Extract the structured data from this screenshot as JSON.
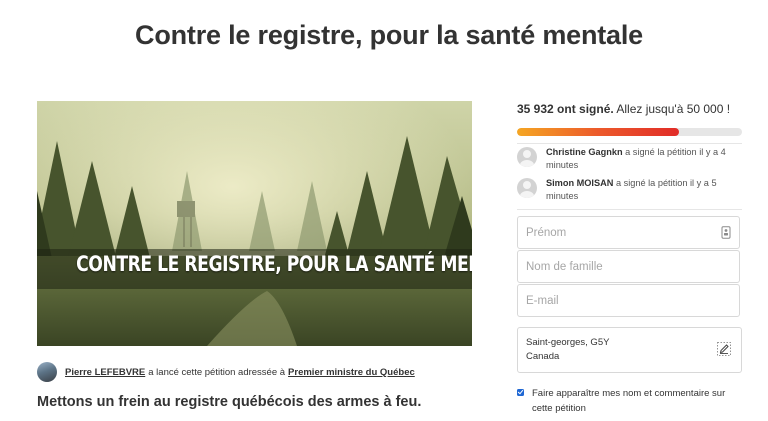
{
  "page": {
    "title": "Contre le registre, pour la santé mentale"
  },
  "hero": {
    "caption": "CONTRE LE REGISTRE, POUR LA SANTÉ MENTALE"
  },
  "starter": {
    "author": "Pierre LEFEBVRE",
    "middle_text": "a lancé cette pétition adressée à",
    "recipient": "Premier ministre du Québec"
  },
  "lead_text": "Mettons un frein au registre québécois des armes à feu.",
  "signatures": {
    "count_text": "35 932 ont signé.",
    "goal_text": "Allez jusqu'à 50 000 !",
    "progress_fraction": 0.72
  },
  "recent_signers": [
    {
      "name": "Christine Gagnkn",
      "action": "a signé la pétition il y a 4 minutes"
    },
    {
      "name": "Simon MOISAN",
      "action": "a signé la pétition il y a 5 minutes"
    }
  ],
  "form": {
    "first_name_placeholder": "Prénom",
    "last_name_placeholder": "Nom de famille",
    "email_placeholder": "E-mail",
    "location_line1": "Saint-georges, G5Y",
    "location_line2": "Canada",
    "consent_label": "Faire apparaître mes nom et commentaire sur cette pétition"
  },
  "colors": {
    "progress_start": "#f5a623",
    "progress_end": "#e12c28",
    "checkbox": "#1f67d3"
  }
}
